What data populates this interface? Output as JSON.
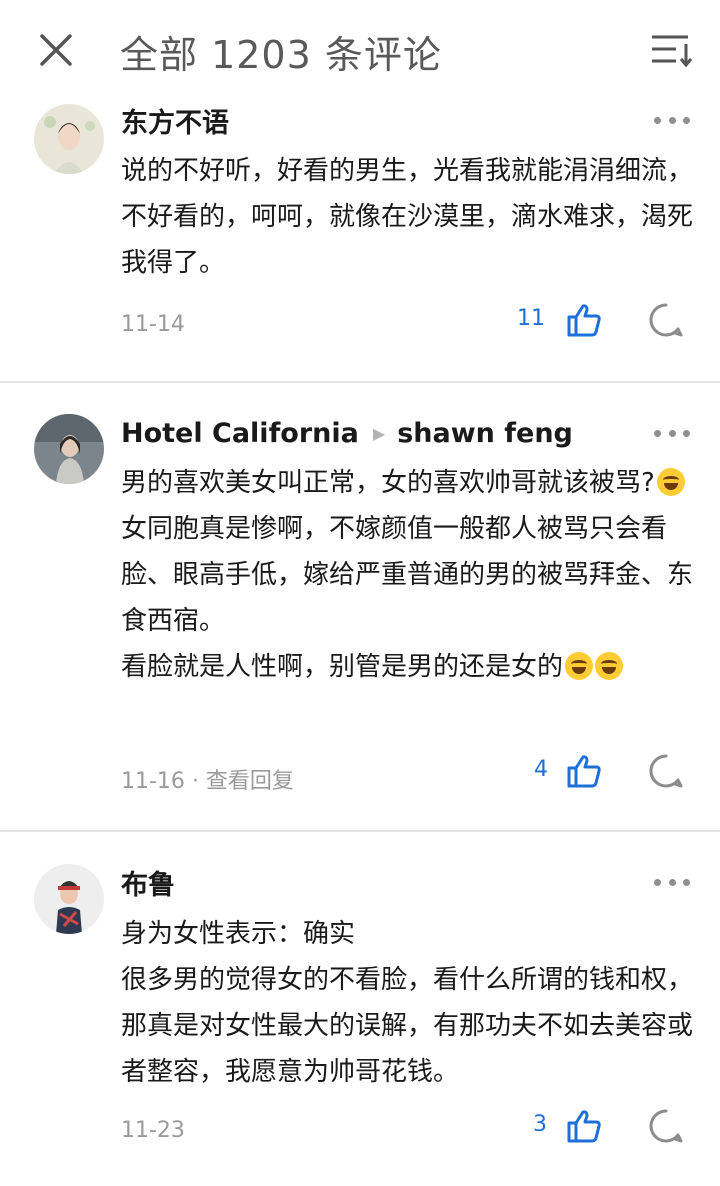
{
  "header": {
    "title": "全部 1203 条评论"
  },
  "comments": [
    {
      "author": "东方不语",
      "reply_to": "",
      "paragraphs": [
        "说的不好听，好看的男生，光看我就能涓涓细流，不好看的，呵呵，就像在沙漠里，滴水难求，渴死我得了。"
      ],
      "date": "11-14",
      "view_replies": "",
      "likes": "11"
    },
    {
      "author": "Hotel California",
      "reply_to": "shawn feng",
      "paragraphs": [
        "男的喜欢美女叫正常，女的喜欢帅哥就该被骂?",
        "女同胞真是惨啊，不嫁颜值一般都人被骂只会看脸、眼高手低，嫁给严重普通的男的被骂拜金、东食西宿。",
        "看脸就是人性啊，别管是男的还是女的"
      ],
      "date": "11-16",
      "view_replies": "· 查看回复",
      "likes": "4"
    },
    {
      "author": "布鲁",
      "reply_to": "",
      "paragraphs": [
        "身为女性表示：确实",
        "很多男的觉得女的不看脸，看什么所谓的钱和权，那真是对女性最大的误解，有那功夫不如去美容或者整容，我愿意为帅哥花钱。"
      ],
      "date": "11-23",
      "view_replies": "",
      "likes": "3"
    }
  ],
  "icons": {
    "close": "close-icon",
    "sort": "sort-icon",
    "more": "more-icon",
    "like": "thumbs-up-icon",
    "reply": "comment-bubble-icon",
    "emoji": "laughing-emoji"
  },
  "colors": {
    "like_count": "#1e6fd9",
    "muted": "#9a9a9a",
    "divider": "#e4e4e4"
  }
}
